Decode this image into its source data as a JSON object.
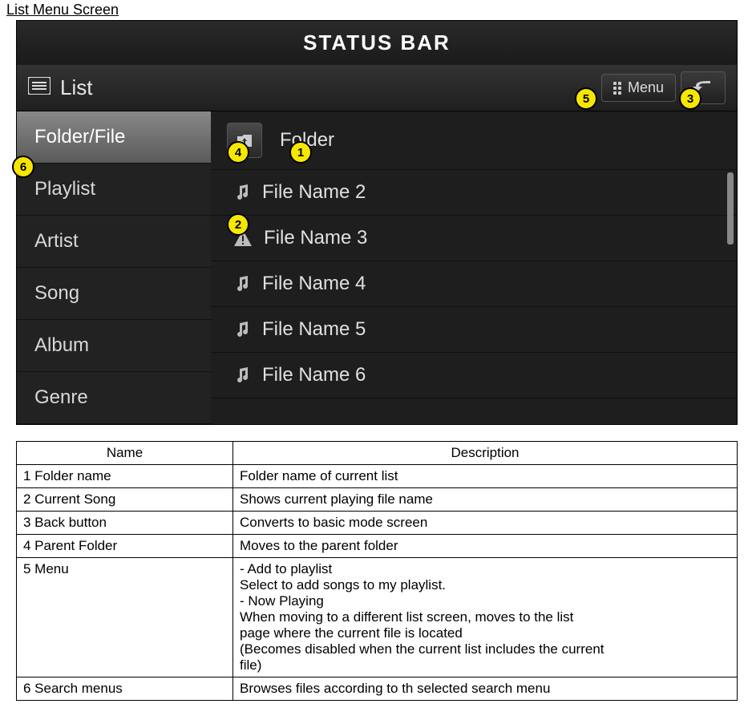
{
  "page_title": "List Menu Screen",
  "status_bar": "STATUS BAR",
  "header": {
    "list_label": "List",
    "menu_label": "Menu"
  },
  "sidebar": {
    "items": [
      {
        "label": "Folder/File",
        "active": true
      },
      {
        "label": "Playlist",
        "active": false
      },
      {
        "label": "Artist",
        "active": false
      },
      {
        "label": "Song",
        "active": false
      },
      {
        "label": "Album",
        "active": false
      },
      {
        "label": "Genre",
        "active": false
      }
    ]
  },
  "files": {
    "folder_label": "Folder",
    "items": [
      {
        "label": "File Name 2",
        "icon": "music"
      },
      {
        "label": "File Name 3",
        "icon": "warn"
      },
      {
        "label": "File Name 4",
        "icon": "music"
      },
      {
        "label": "File Name 5",
        "icon": "music"
      },
      {
        "label": "File Name 6",
        "icon": "music"
      }
    ]
  },
  "callouts": {
    "c1": "1",
    "c2": "2",
    "c3": "3",
    "c4": "4",
    "c5": "5",
    "c6": "6"
  },
  "table": {
    "head_name": "Name",
    "head_desc": "Description",
    "rows": [
      {
        "name": "1 Folder name",
        "desc": [
          "Folder name of current list"
        ]
      },
      {
        "name": "2 Current Song",
        "desc": [
          "Shows current playing file name"
        ]
      },
      {
        "name": "3 Back button",
        "desc": [
          "Converts to basic mode screen"
        ]
      },
      {
        "name": "4 Parent Folder",
        "desc": [
          "Moves to the parent folder"
        ]
      },
      {
        "name": "5 Menu",
        "desc": [
          "- Add to playlist",
          "Select to add songs   to my playlist.",
          "- Now Playing",
          "When moving to a different list screen, moves to the list",
          "page where the current file is located",
          "(Becomes disabled when the current list includes the current",
          "file)"
        ]
      },
      {
        "name": "6 Search menus",
        "desc": [
          "Browses files according to th selected search menu"
        ]
      }
    ]
  }
}
